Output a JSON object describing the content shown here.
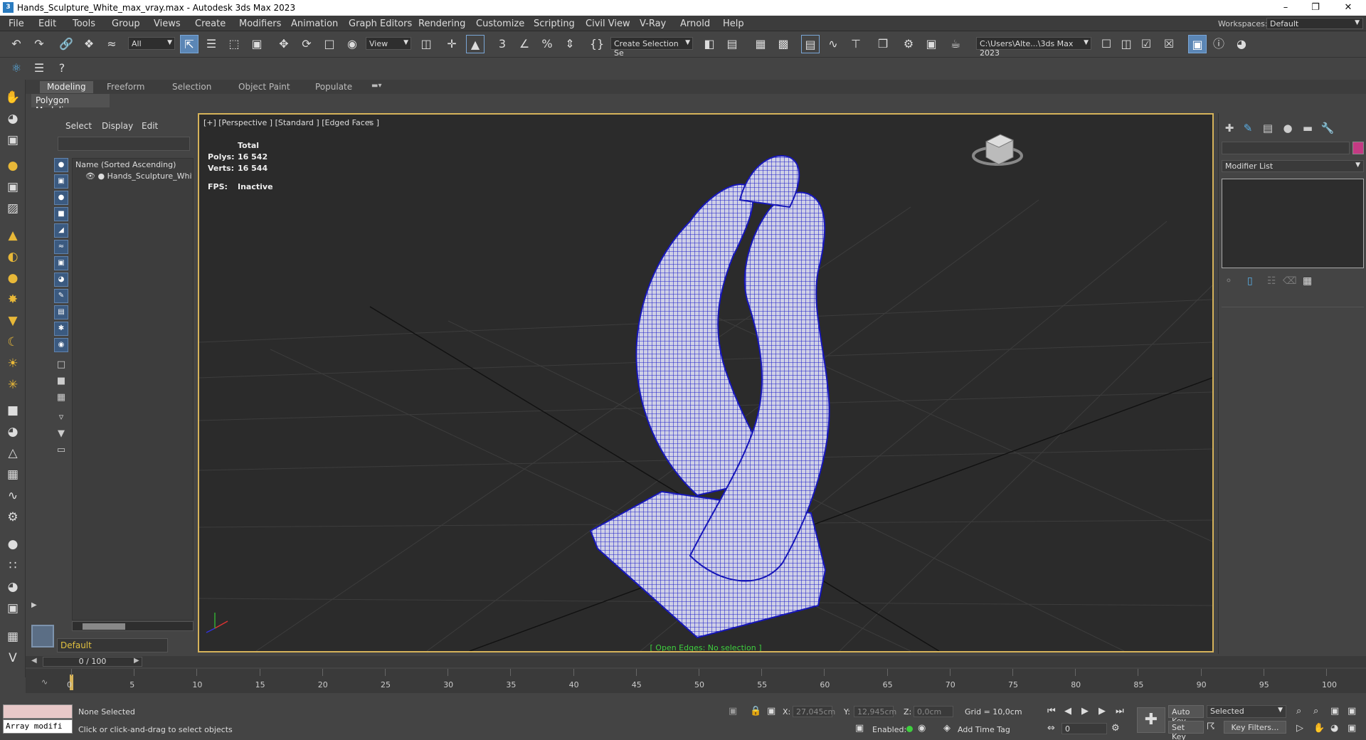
{
  "window": {
    "title": "Hands_Sculpture_White_max_vray.max - Autodesk 3ds Max 2023"
  },
  "menu": [
    "File",
    "Edit",
    "Tools",
    "Group",
    "Views",
    "Create",
    "Modifiers",
    "Animation",
    "Graph Editors",
    "Rendering",
    "Customize",
    "Scripting",
    "Civil View",
    "V-Ray",
    "Arnold",
    "Help"
  ],
  "workspace": {
    "label": "Workspaces:",
    "value": "Default"
  },
  "toolbar": {
    "filter": "All",
    "ref_coord": "View",
    "selection_set": "Create Selection Se",
    "path": "C:\\Users\\Alte...\\3ds Max 2023"
  },
  "ribbon": {
    "tabs": [
      "Modeling",
      "Freeform",
      "Selection",
      "Object Paint",
      "Populate"
    ],
    "active": "Modeling",
    "subpanel": "Polygon Modeling"
  },
  "explorer": {
    "tabs": [
      "Select",
      "Display",
      "Edit"
    ],
    "column": "Name (Sorted Ascending)",
    "object": "Hands_Sculpture_White",
    "layer": "Default"
  },
  "viewport": {
    "label": "[+] [Perspective ] [Standard ] [Edged Faces ]",
    "stats_title": "Total",
    "polys_label": "Polys:",
    "polys": "16 542",
    "verts_label": "Verts:",
    "verts": "16 544",
    "fps_label": "FPS:",
    "fps": "Inactive",
    "message": "[ Open Edges: No selection ]"
  },
  "cmdpanel": {
    "modifier_list": "Modifier List",
    "object_color": "#c43a83"
  },
  "timeline": {
    "frame": "0 / 100",
    "ticks": [
      "0",
      "5",
      "10",
      "15",
      "20",
      "25",
      "30",
      "35",
      "40",
      "45",
      "50",
      "55",
      "60",
      "65",
      "70",
      "75",
      "80",
      "85",
      "90",
      "95",
      "100"
    ]
  },
  "status": {
    "selection": "None Selected",
    "prompt": "Click or click-and-drag to select objects",
    "maxscript": "Array modifi",
    "x_label": "X:",
    "x": "27,045cm",
    "y_label": "Y:",
    "y": "12,945cm",
    "z_label": "Z:",
    "z": "0,0cm",
    "grid": "Grid = 10,0cm",
    "enabled": "Enabled:",
    "add_time_tag": "Add Time Tag",
    "auto_key": "Auto Key",
    "set_key": "Set Key",
    "selected": "Selected",
    "key_filters": "Key Filters...",
    "frame_field": "0"
  },
  "colors": {
    "accent": "#5b86b5",
    "viewport_border": "#d6b35a",
    "wire": "#2a2ad6",
    "message": "#3ecf3e"
  }
}
